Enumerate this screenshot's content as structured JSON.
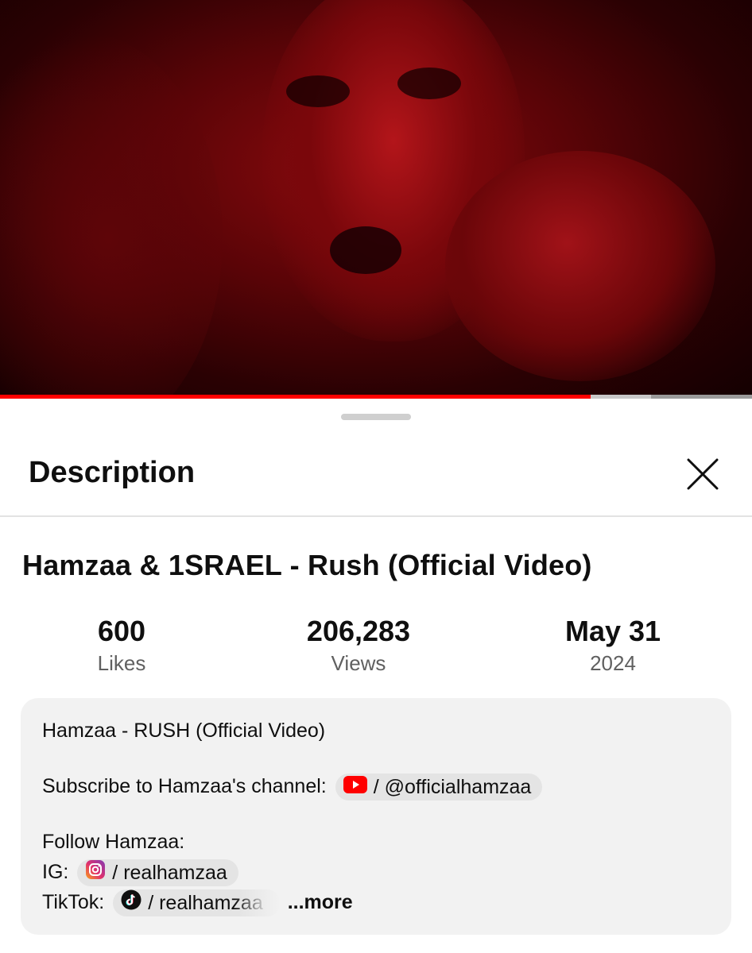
{
  "player": {
    "progress_fraction": 0.785,
    "buffered_fraction": 0.08
  },
  "sheet": {
    "title": "Description",
    "close_icon": "close-icon"
  },
  "video": {
    "title": "Hamzaa & 1SRAEL - Rush (Official Video)"
  },
  "stats": [
    {
      "value": "600",
      "label": "Likes"
    },
    {
      "value": "206,283",
      "label": "Views"
    },
    {
      "value": "May 31",
      "label": "2024"
    }
  ],
  "description": {
    "line1": "Hamzaa - RUSH (Official Video)",
    "subscribe_prefix": "Subscribe to Hamzaa's channel:",
    "youtube_chip": "/ @officialhamzaa",
    "follow": "Follow Hamzaa:",
    "ig_prefix": "IG:",
    "ig_chip": "/ realhamzaa",
    "tiktok_prefix": "TikTok:",
    "tiktok_chip": "/ realhamzaa",
    "more": "...more"
  },
  "icons": {
    "youtube": "youtube-icon",
    "instagram": "instagram-icon",
    "tiktok": "tiktok-icon"
  },
  "colors": {
    "accent_red": "#ff0000",
    "box_bg": "#f2f2f2",
    "chip_bg": "#e4e4e4",
    "muted_text": "#606060"
  }
}
